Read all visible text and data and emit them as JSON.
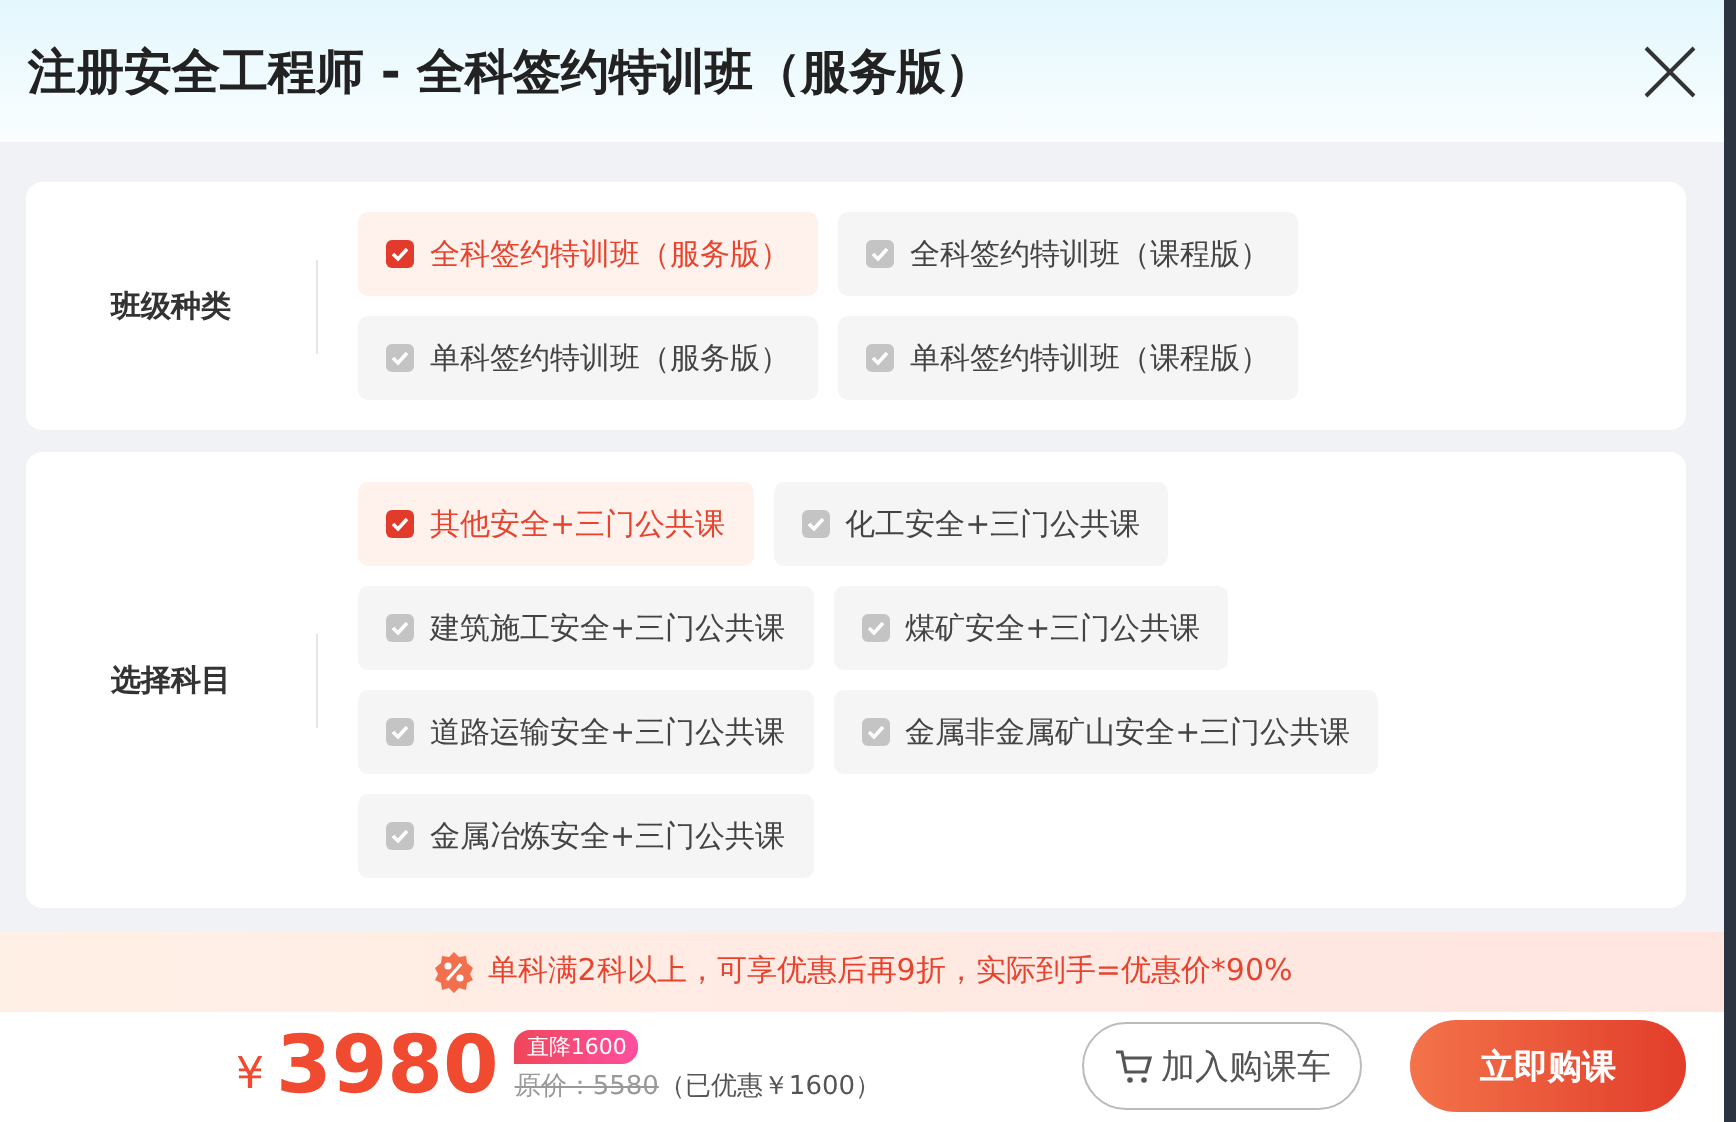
{
  "title": "注册安全工程师 - 全科签约特训班（服务版）",
  "sections": [
    {
      "label": "班级种类",
      "options": [
        {
          "label": "全科签约特训班（服务版）",
          "selected": true
        },
        {
          "label": "全科签约特训班（课程版）",
          "selected": false
        },
        {
          "label": "单科签约特训班（服务版）",
          "selected": false
        },
        {
          "label": "单科签约特训班（课程版）",
          "selected": false
        }
      ]
    },
    {
      "label": "选择科目",
      "options": [
        {
          "label": "其他安全+三门公共课",
          "selected": true
        },
        {
          "label": "化工安全+三门公共课",
          "selected": false
        },
        {
          "label": "建筑施工安全+三门公共课",
          "selected": false
        },
        {
          "label": "煤矿安全+三门公共课",
          "selected": false
        },
        {
          "label": "道路运输安全+三门公共课",
          "selected": false
        },
        {
          "label": "金属非金属矿山安全+三门公共课",
          "selected": false
        },
        {
          "label": "金属冶炼安全+三门公共课",
          "selected": false
        }
      ]
    }
  ],
  "promo": "单科满2科以上，可享优惠后再9折，实际到手=优惠价*90%",
  "price": {
    "currency": "¥",
    "amount": "3980",
    "badge": "直降1600",
    "original": "原价：5580",
    "saved": "（已优惠￥1600）"
  },
  "buttons": {
    "cart": "加入购课车",
    "buy": "立即购课"
  }
}
